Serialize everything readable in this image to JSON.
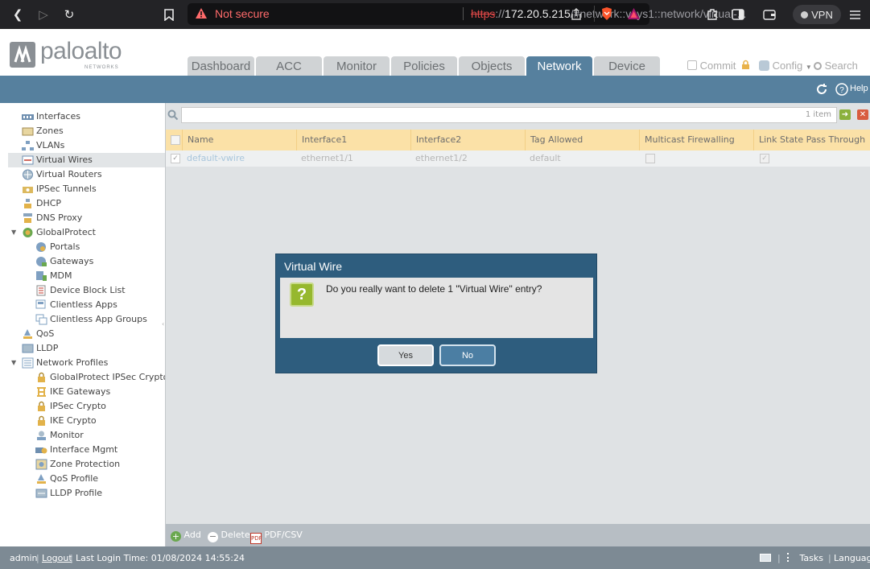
{
  "browser": {
    "not_secure": "Not secure",
    "url_scheme": "https",
    "url_sep": "://",
    "url_host": "172.20.5.215",
    "url_path": "/#network::vsys1::network/virtual-...",
    "vpn": "VPN"
  },
  "brand": {
    "name": "paloalto",
    "sub": "NETWORKS"
  },
  "tabs": [
    {
      "label": "Dashboard"
    },
    {
      "label": "ACC"
    },
    {
      "label": "Monitor"
    },
    {
      "label": "Policies"
    },
    {
      "label": "Objects"
    },
    {
      "label": "Network",
      "active": true
    },
    {
      "label": "Device"
    }
  ],
  "top_actions": {
    "commit": "Commit",
    "config": "Config",
    "search": "Search"
  },
  "band": {
    "help": "Help"
  },
  "sidebar": {
    "items": [
      {
        "label": "Interfaces",
        "icon": "interfaces-icon"
      },
      {
        "label": "Zones",
        "icon": "zones-icon"
      },
      {
        "label": "VLANs",
        "icon": "vlans-icon"
      },
      {
        "label": "Virtual Wires",
        "icon": "virtual-wires-icon",
        "selected": true
      },
      {
        "label": "Virtual Routers",
        "icon": "virtual-routers-icon"
      },
      {
        "label": "IPSec Tunnels",
        "icon": "ipsec-tunnels-icon"
      },
      {
        "label": "DHCP",
        "icon": "dhcp-icon"
      },
      {
        "label": "DNS Proxy",
        "icon": "dns-proxy-icon"
      },
      {
        "label": "GlobalProtect",
        "icon": "globalprotect-icon"
      },
      {
        "label": "Portals",
        "icon": "portals-icon"
      },
      {
        "label": "Gateways",
        "icon": "gateways-icon"
      },
      {
        "label": "MDM",
        "icon": "mdm-icon"
      },
      {
        "label": "Device Block List",
        "icon": "device-block-list-icon"
      },
      {
        "label": "Clientless Apps",
        "icon": "clientless-apps-icon"
      },
      {
        "label": "Clientless App Groups",
        "icon": "clientless-app-groups-icon"
      },
      {
        "label": "QoS",
        "icon": "qos-icon"
      },
      {
        "label": "LLDP",
        "icon": "lldp-icon"
      },
      {
        "label": "Network Profiles",
        "icon": "network-profiles-icon"
      },
      {
        "label": "GlobalProtect IPSec Crypto",
        "icon": "lock-icon"
      },
      {
        "label": "IKE Gateways",
        "icon": "ike-gateways-icon"
      },
      {
        "label": "IPSec Crypto",
        "icon": "lock-icon"
      },
      {
        "label": "IKE Crypto",
        "icon": "lock-icon"
      },
      {
        "label": "Monitor",
        "icon": "monitor-icon"
      },
      {
        "label": "Interface Mgmt",
        "icon": "interface-mgmt-icon"
      },
      {
        "label": "Zone Protection",
        "icon": "zone-protection-icon"
      },
      {
        "label": "QoS Profile",
        "icon": "qos-profile-icon"
      },
      {
        "label": "LLDP Profile",
        "icon": "lldp-profile-icon"
      }
    ]
  },
  "table": {
    "count": "1 item",
    "headers": [
      "Name",
      "Interface1",
      "Interface2",
      "Tag Allowed",
      "Multicast Firewalling",
      "Link State Pass Through"
    ],
    "rows": [
      {
        "name": "default-vwire",
        "interface1": "ethernet1/1",
        "interface2": "ethernet1/2",
        "tag_allowed": "default",
        "multicast": false,
        "link_state": true,
        "checked": true
      }
    ]
  },
  "bottom": {
    "add": "Add",
    "delete": "Delete",
    "pdf": "PDF/CSV"
  },
  "status": {
    "user": "admin",
    "logout": "Logout",
    "last_login": "Last Login Time: 01/08/2024 14:55:24",
    "tasks": "Tasks",
    "language": "Language"
  },
  "dialog": {
    "title": "Virtual Wire",
    "message": "Do you really want to delete 1 \"Virtual Wire\" entry?",
    "yes": "Yes",
    "no": "No"
  },
  "colors": {
    "accent": "#56809e",
    "dialog": "#2e5d7e",
    "header_row": "#fbe1a7"
  }
}
